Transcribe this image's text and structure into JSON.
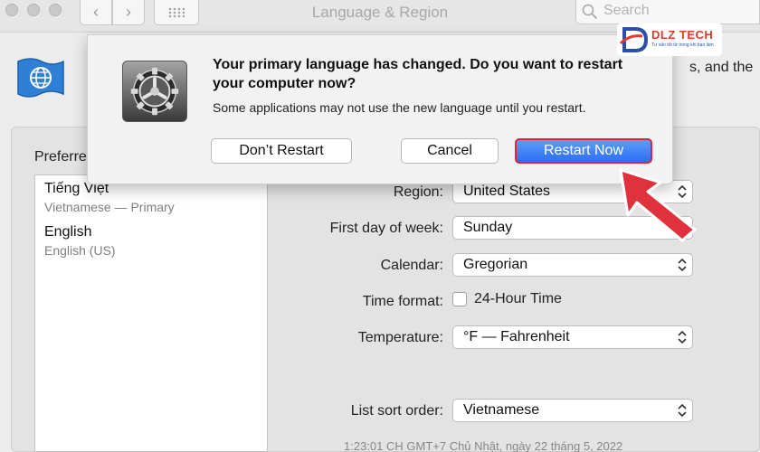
{
  "window": {
    "title": "Language & Region",
    "search_placeholder": "Search"
  },
  "behind_header_text": "s, and the",
  "preferred_label": "Preferre",
  "languages": [
    {
      "name": "Tiếng Việt",
      "sub": "Vietnamese — Primary"
    },
    {
      "name": "English",
      "sub": "English (US)"
    }
  ],
  "settings": {
    "region_label": "Region:",
    "region_value": "United States",
    "first_day_label": "First day of week:",
    "first_day_value": "Sunday",
    "calendar_label": "Calendar:",
    "calendar_value": "Gregorian",
    "time_format_label": "Time format:",
    "time_format_option": "24-Hour Time",
    "time_format_checked": false,
    "temperature_label": "Temperature:",
    "temperature_value": "°F — Fahrenheit",
    "sort_label": "List sort order:",
    "sort_value": "Vietnamese"
  },
  "clock_text": "1:23:01 CH GMT+7 Chủ Nhật, ngày 22 tháng 5, 2022",
  "dialog": {
    "title": "Your primary language has changed. Do you want to restart your computer now?",
    "body": "Some applications may not use the new language until you restart.",
    "dont_restart_label": "Don’t Restart",
    "cancel_label": "Cancel",
    "restart_now_label": "Restart Now"
  },
  "watermark": {
    "brand": "DLZ TECH",
    "tagline": "Tư vấn tốt từ trong khi bạn làm"
  },
  "colors": {
    "primary_button": "#2d6ff0",
    "highlight_border": "#d8263a",
    "annotation_arrow": "#e0323d"
  }
}
